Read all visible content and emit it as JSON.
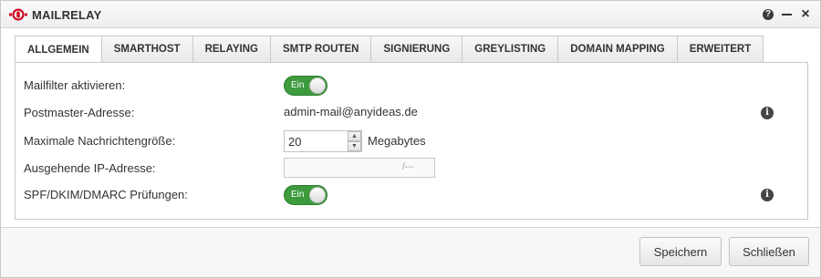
{
  "window": {
    "title": "MAILRELAY",
    "controls": {
      "help_icon": "help-icon",
      "minimize_icon": "minimize-icon",
      "close_icon": "close-icon"
    }
  },
  "tabs": [
    {
      "label": "ALLGEMEIN",
      "active": true
    },
    {
      "label": "SMARTHOST",
      "active": false
    },
    {
      "label": "RELAYING",
      "active": false
    },
    {
      "label": "SMTP ROUTEN",
      "active": false
    },
    {
      "label": "SIGNIERUNG",
      "active": false
    },
    {
      "label": "GREYLISTING",
      "active": false
    },
    {
      "label": "DOMAIN MAPPING",
      "active": false
    },
    {
      "label": "ERWEITERT",
      "active": false
    }
  ],
  "form": {
    "mailfilter": {
      "label": "Mailfilter aktivieren:",
      "toggle_text": "Ein",
      "on": true
    },
    "postmaster": {
      "label": "Postmaster-Adresse:",
      "value": "admin-mail@anyideas.de"
    },
    "max_size": {
      "label": "Maximale Nachrichtengröße:",
      "value": "20",
      "unit": "Megabytes"
    },
    "outgoing_ip": {
      "label": "Ausgehende IP-Adresse:",
      "value": "",
      "suffix": "/---"
    },
    "spf": {
      "label": "SPF/DKIM/DMARC Prüfungen:",
      "toggle_text": "Ein",
      "on": true
    }
  },
  "footer": {
    "save_label": "Speichern",
    "close_label": "Schließen"
  },
  "colors": {
    "toggle_on": "#3d9a3d",
    "logo_red": "#d0021b"
  }
}
